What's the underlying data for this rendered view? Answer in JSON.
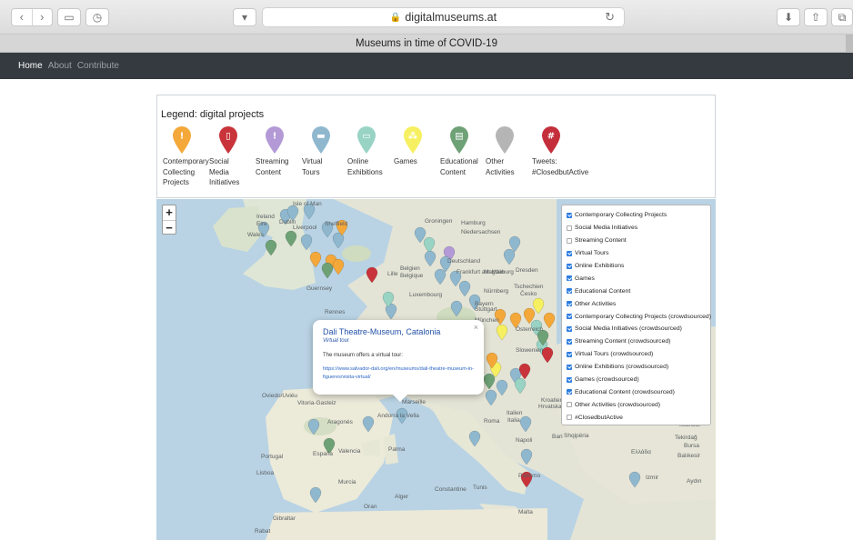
{
  "browser": {
    "url": "digitalmuseums.at",
    "tab_title": "Museums in time of COVID-19"
  },
  "nav": [
    {
      "label": "Home",
      "active": true
    },
    {
      "label": "About",
      "active": false
    },
    {
      "label": "Contribute",
      "active": false
    }
  ],
  "legend": {
    "title": "Legend: digital projects",
    "items": [
      {
        "label": "Contemporary\nCollecting\nProjects",
        "color": "#f4a83a",
        "icon": "exclamation-icon"
      },
      {
        "label": "Social\nMedia\nInitiatives",
        "color": "#c9343a",
        "icon": "mobile-phone-icon"
      },
      {
        "label": "Streaming\nContent",
        "color": "#b39ad6",
        "icon": "exclamation-icon"
      },
      {
        "label": "Virtual\nTours",
        "color": "#8fb8cf",
        "icon": "speech-bubble-icon"
      },
      {
        "label": "Online\nExhibitions",
        "color": "#98d3c4",
        "icon": "monitor-icon"
      },
      {
        "label": "Games",
        "color": "#f6f060",
        "icon": "dice-icon"
      },
      {
        "label": "Educational\nContent",
        "color": "#6fa176",
        "icon": "book-icon"
      },
      {
        "label": "Other\nActivities",
        "color": "#b5b5b5",
        "icon": "pin-icon"
      },
      {
        "label": "Tweets:\n#ClosedbutActive",
        "color": "#c42e3b",
        "icon": "hashtag-icon"
      }
    ]
  },
  "map": {
    "zoom_in": "+",
    "zoom_out": "−",
    "places": [
      "Isle of Man",
      "Ireland",
      "Eire",
      "Dublin",
      "Liverpool",
      "Sheffield",
      "Wales",
      "Groningen",
      "Hamburg",
      "Niedersachsen",
      "Deutschland",
      "Magdeburg",
      "Dresden",
      "Belgien",
      "Belgique",
      "Frankfurt am Main",
      "Lille",
      "Luxembourg",
      "Guernsey",
      "Nürnberg",
      "Tschechien",
      "Česko",
      "Stuttgart",
      "Bayern",
      "Rennes",
      "München",
      "Österreich",
      "Slowenien",
      "Kroatien",
      "Hrvatska",
      "Marseille",
      "Oviedo/Uviéu",
      "Vitoria-Gasteiz",
      "Andorra la Vella",
      "Aragonés",
      "España",
      "Valencia",
      "Palma",
      "Portugal",
      "Lisboa",
      "Murcia",
      "Italien",
      "Italia",
      "Roma",
      "Napoli",
      "Bari",
      "Shqipëria",
      "Palermo",
      "Tunis",
      "Constantine",
      "Alger",
      "Oran",
      "Gibraltar",
      "Rabat",
      "Malta",
      "Ελλάδα",
      "Tekirdağ",
      "Bursa",
      "Balıkesir",
      "Istanbul",
      "Aydın",
      "Izmir"
    ],
    "layers": [
      {
        "label": "Contemporary Collecting Projects",
        "checked": true
      },
      {
        "label": "Social Media Initiatives",
        "checked": false
      },
      {
        "label": "Streaming Content",
        "checked": false
      },
      {
        "label": "Virtual Tours",
        "checked": true
      },
      {
        "label": "Online Exhibitions",
        "checked": true
      },
      {
        "label": "Games",
        "checked": true
      },
      {
        "label": "Educational Content",
        "checked": true
      },
      {
        "label": "Other Activities",
        "checked": true
      },
      {
        "label": "Contemporary Collecting Projects (crowdsourced)",
        "checked": true
      },
      {
        "label": "Social Media Initiatives (crowdsourced)",
        "checked": true
      },
      {
        "label": "Streaming Content (crowdsourced)",
        "checked": true
      },
      {
        "label": "Virtual Tours (crowdsourced)",
        "checked": true
      },
      {
        "label": "Online Exhibitions (crowdsourced)",
        "checked": true
      },
      {
        "label": "Games (crowdsourced)",
        "checked": true
      },
      {
        "label": "Educational Content (crowdsourced)",
        "checked": true
      },
      {
        "label": "Other Activities (crowdsourced)",
        "checked": false
      },
      {
        "label": "#ClosedbutActive",
        "checked": false
      }
    ],
    "popup": {
      "title": "Dali Theatre-Museum, Catalonia",
      "subtitle": "Virtual tour",
      "description": "The museum offers a virtual tour:",
      "link": "https://www.salvador-dali.org/en/museums/dali-theatre-museum-in-figueres/visita-virtual/",
      "close": "×"
    }
  }
}
